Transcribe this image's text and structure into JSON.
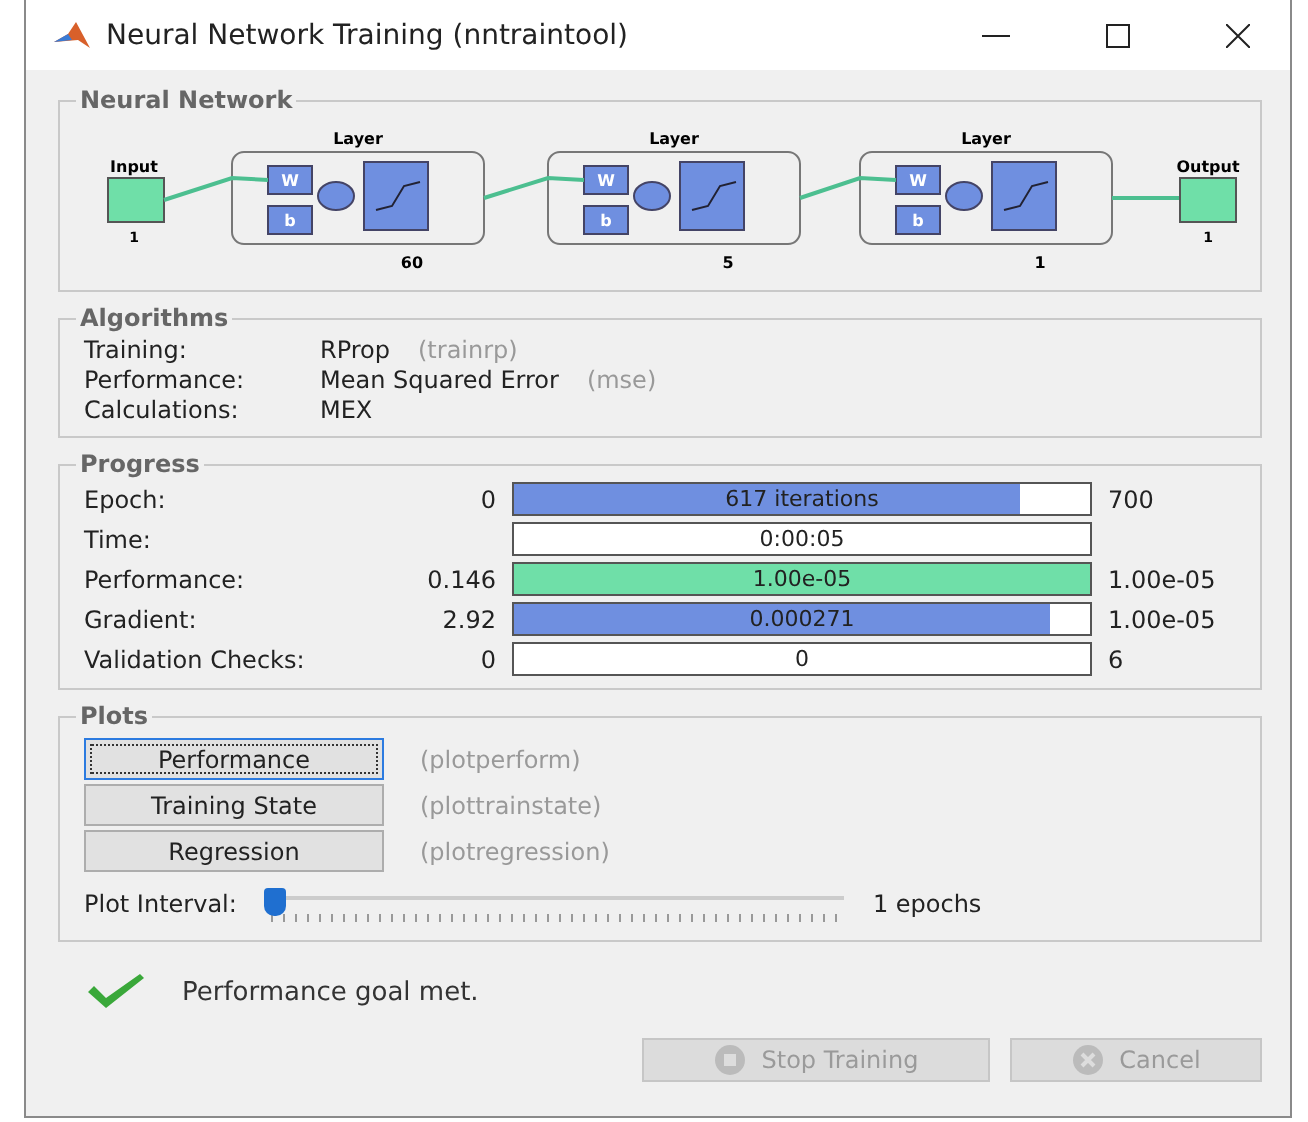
{
  "window": {
    "title": "Neural Network Training (nntraintool)"
  },
  "network": {
    "legend": "Neural Network",
    "input": {
      "label": "Input",
      "size": "1"
    },
    "output": {
      "label": "Output",
      "size": "1"
    },
    "layers": [
      {
        "label": "Layer",
        "size": "60",
        "weight": "W",
        "bias": "b"
      },
      {
        "label": "Layer",
        "size": "5",
        "weight": "W",
        "bias": "b"
      },
      {
        "label": "Layer",
        "size": "1",
        "weight": "W",
        "bias": "b"
      }
    ]
  },
  "algorithms": {
    "legend": "Algorithms",
    "rows": [
      {
        "label": "Training:",
        "value": "RProp",
        "func": "(trainrp)"
      },
      {
        "label": "Performance:",
        "value": "Mean Squared Error",
        "func": "(mse)"
      },
      {
        "label": "Calculations:",
        "value": "MEX"
      }
    ]
  },
  "progress": {
    "legend": "Progress",
    "rows": [
      {
        "label": "Epoch:",
        "start": "0",
        "bar_text": "617 iterations",
        "level": 0.88,
        "color": "#6f8fe0",
        "end": "700"
      },
      {
        "label": "Time:",
        "bar_text": "0:00:05"
      },
      {
        "label": "Performance:",
        "start": "0.146",
        "bar_text": "1.00e-05",
        "level": 1,
        "color": "#6fdfa8",
        "end": "1.00e-05"
      },
      {
        "label": "Gradient:",
        "start": "2.92",
        "bar_text": "0.000271",
        "level": 0.93,
        "color": "#6f8fe0",
        "end": "1.00e-05"
      },
      {
        "label": "Validation Checks:",
        "start": "0",
        "bar_text": "0",
        "end": "6"
      }
    ]
  },
  "plots": {
    "legend": "Plots",
    "buttons": [
      {
        "label": "Performance",
        "func": "(plotperform)",
        "selected": true
      },
      {
        "label": "Training State",
        "func": "(plottrainstate)",
        "selected": false
      },
      {
        "label": "Regression",
        "func": "(plotregression)",
        "selected": false
      }
    ],
    "interval": {
      "label": "Plot Interval:",
      "level": 0,
      "reading": "1 epochs"
    }
  },
  "status": {
    "message": "Performance goal met."
  },
  "buttons": [
    {
      "label": "Stop Training",
      "disabled": true,
      "kind": "stop"
    },
    {
      "label": "Cancel",
      "disabled": true,
      "kind": "cancel"
    }
  ]
}
